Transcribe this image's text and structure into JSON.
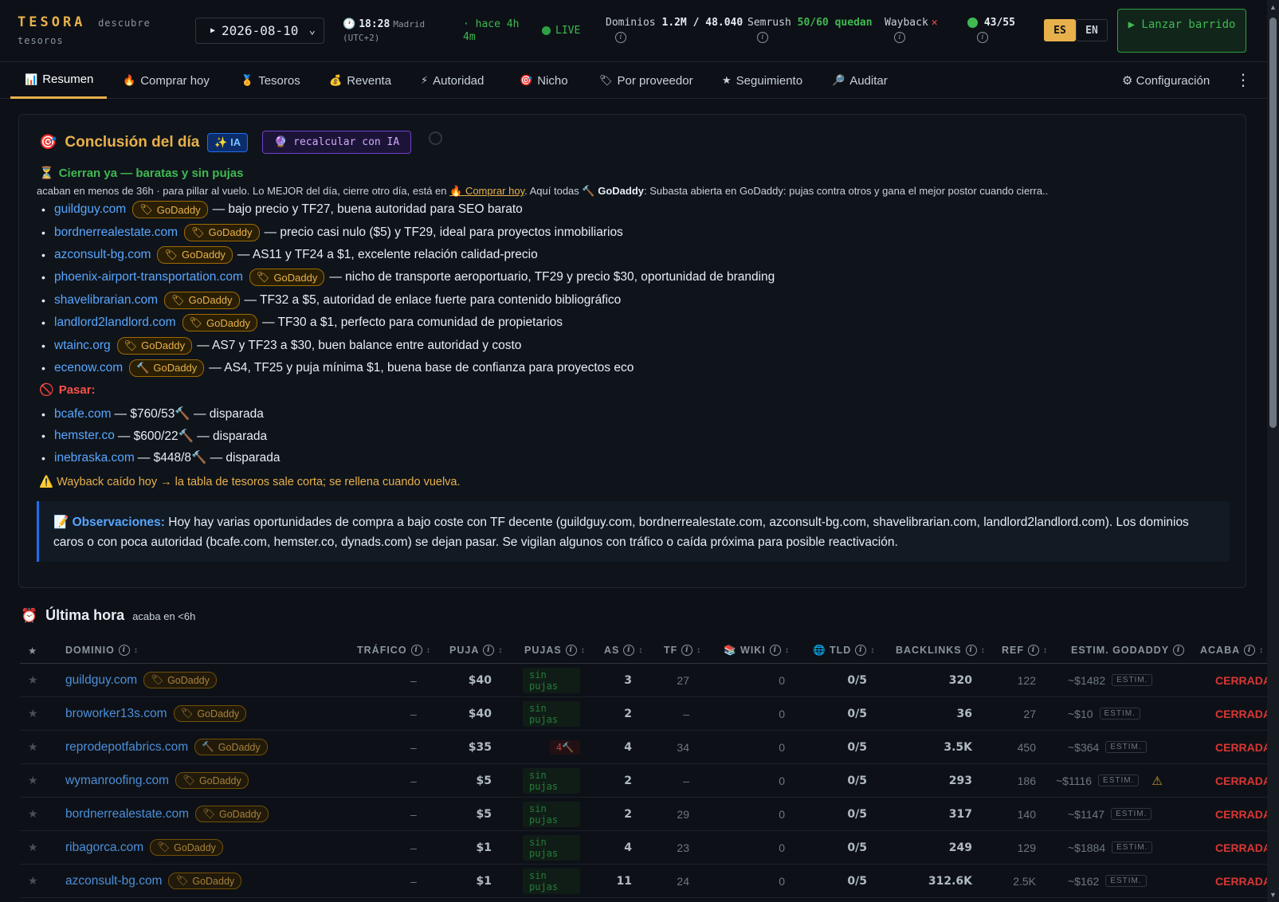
{
  "brand": {
    "name": "TESORA",
    "tagline": "descubre",
    "tagline2": "tesoros"
  },
  "header": {
    "date": "2026-08-10",
    "time": "18:28",
    "city": "Madrid",
    "tz": "(UTC+2)",
    "ago": "· hace 4h 4m",
    "live": "LIVE",
    "dominios_label": "Dominios",
    "dominios_value": "1.2M / 48.040",
    "semrush_label": "Semrush",
    "semrush_value": "50/60 quedan",
    "wayback_label": "Wayback",
    "wayback_status": "✕",
    "counter": "43/55",
    "lang_es": "ES",
    "lang_en": "EN",
    "launch_label": "▶ Lanzar barrido"
  },
  "tabs": [
    {
      "label": "Resumen",
      "icon": "📊"
    },
    {
      "label": "Comprar hoy",
      "icon": "🔥"
    },
    {
      "label": "Tesoros",
      "icon": "🏅"
    },
    {
      "label": "Reventa",
      "icon": "💰"
    },
    {
      "label": "Autoridad",
      "icon": "⚡"
    },
    {
      "label": "Nicho",
      "icon": "🎯"
    },
    {
      "label": "Por proveedor",
      "icon": "🏷"
    },
    {
      "label": "Seguimiento",
      "icon": "★"
    },
    {
      "label": "Auditar",
      "icon": "🔎"
    }
  ],
  "config_label": "⚙ Configuración",
  "conclusion": {
    "title": "Conclusión del día",
    "ia_badge": "✨ IA",
    "recalc_label": "🔮 recalcular con IA",
    "section1_title": "Cierran ya — baratas y sin pujas",
    "sub_a": "acaban en menos de 36h · para pillar al vuelo. Lo MEJOR del día, cierre otro día, está en ",
    "sub_link": "🔥 Comprar hoy",
    "sub_b": ". Aquí todas 🔨 ",
    "sub_bold": "GoDaddy",
    "sub_c": ": Subasta abierta en GoDaddy: pujas contra otros y gana el mejor postor cuando cierra..",
    "godaddy": "GoDaddy",
    "items": [
      {
        "domain": "guildguy.com",
        "icon": "🏷",
        "note": "— bajo precio y TF27, buena autoridad para SEO barato"
      },
      {
        "domain": "bordnerrealestate.com",
        "icon": "🏷",
        "note": "— precio casi nulo ($5) y TF29, ideal para proyectos inmobiliarios"
      },
      {
        "domain": "azconsult-bg.com",
        "icon": "🏷",
        "note": "— AS11 y TF24 a $1, excelente relación calidad-precio"
      },
      {
        "domain": "phoenix-airport-transportation.com",
        "icon": "🏷",
        "note": "— nicho de transporte aeroportuario, TF29 y precio $30, oportunidad de branding"
      },
      {
        "domain": "shavelibrarian.com",
        "icon": "🏷",
        "note": "— TF32 a $5, autoridad de enlace fuerte para contenido bibliográfico"
      },
      {
        "domain": "landlord2landlord.com",
        "icon": "🏷",
        "note": "— TF30 a $1, perfecto para comunidad de propietarios"
      },
      {
        "domain": "wtainc.org",
        "icon": "🏷",
        "note": "— AS7 y TF23 a $30, buen balance entre autoridad y costo"
      },
      {
        "domain": "ecenow.com",
        "icon": "🔨",
        "note": "— AS4, TF25 y puja mínima $1, buena base de confianza para proyectos eco"
      }
    ],
    "pass_title": "Pasar:",
    "pass_items": [
      {
        "domain": "bcafe.com",
        "note": "— $760/53🔨 — disparada"
      },
      {
        "domain": "hemster.co",
        "note": "— $600/22🔨 — disparada"
      },
      {
        "domain": "inebraska.com",
        "note": "— $448/8🔨 — disparada"
      }
    ],
    "warning": "⚠️ Wayback caído hoy → la tabla de tesoros sale corta; se rellena cuando vuelva.",
    "obs_label": "Observaciones:",
    "obs_text": " Hoy hay varias oportunidades de compra a bajo coste con TF decente (guildguy.com, bordnerrealestate.com, azconsult-bg.com, shavelibrarian.com, landlord2landlord.com). Los dominios caros o con poca autoridad (bcafe.com, hemster.co, dynads.com) se dejan pasar. Se vigilan algunos con tráfico o caída próxima para posible reactivación."
  },
  "ultima": {
    "title": "Última hora",
    "subtitle": "acaba en <6h",
    "columns": [
      "★",
      "DOMINIO",
      "TRÁFICO",
      "PUJA",
      "PUJAS",
      "AS",
      "TF",
      "📚 WIKI",
      "🌐 TLD",
      "BACKLINKS",
      "REF",
      "ESTIM. GODADDY",
      "ACABA"
    ],
    "estim_label": "ESTIM.",
    "rows": [
      {
        "domain": "guildguy.com",
        "prov_icon": "🏷",
        "traffic": "–",
        "bid": "$40",
        "bids": "sin pujas",
        "as": "3",
        "tf": "27",
        "wiki": "0",
        "tld": "0/5",
        "backlinks": "320",
        "ref": "122",
        "estim": "~$1482",
        "status": "CERRADA",
        "warn": ""
      },
      {
        "domain": "broworker13s.com",
        "prov_icon": "🏷",
        "traffic": "–",
        "bid": "$40",
        "bids": "sin pujas",
        "as": "2",
        "tf": "–",
        "wiki": "0",
        "tld": "0/5",
        "backlinks": "36",
        "ref": "27",
        "estim": "~$10",
        "status": "CERRADA",
        "warn": ""
      },
      {
        "domain": "reprodepotfabrics.com",
        "prov_icon": "🔨",
        "traffic": "–",
        "bid": "$35",
        "bids": "4🔨",
        "as": "4",
        "tf": "34",
        "wiki": "0",
        "tld": "0/5",
        "backlinks": "3.5K",
        "ref": "450",
        "estim": "~$364",
        "status": "CERRADA",
        "warn": ""
      },
      {
        "domain": "wymanroofing.com",
        "prov_icon": "🏷",
        "traffic": "–",
        "bid": "$5",
        "bids": "sin pujas",
        "as": "2",
        "tf": "–",
        "wiki": "0",
        "tld": "0/5",
        "backlinks": "293",
        "ref": "186",
        "estim": "~$1116",
        "status": "CERRADA",
        "warn": "⚠"
      },
      {
        "domain": "bordnerrealestate.com",
        "prov_icon": "🏷",
        "traffic": "–",
        "bid": "$5",
        "bids": "sin pujas",
        "as": "2",
        "tf": "29",
        "wiki": "0",
        "tld": "0/5",
        "backlinks": "317",
        "ref": "140",
        "estim": "~$1147",
        "status": "CERRADA",
        "warn": ""
      },
      {
        "domain": "ribagorca.com",
        "prov_icon": "🏷",
        "traffic": "–",
        "bid": "$1",
        "bids": "sin pujas",
        "as": "4",
        "tf": "23",
        "wiki": "0",
        "tld": "0/5",
        "backlinks": "249",
        "ref": "129",
        "estim": "~$1884",
        "status": "CERRADA",
        "warn": ""
      },
      {
        "domain": "azconsult-bg.com",
        "prov_icon": "🏷",
        "traffic": "–",
        "bid": "$1",
        "bids": "sin pujas",
        "as": "11",
        "tf": "24",
        "wiki": "0",
        "tld": "0/5",
        "backlinks": "312.6K",
        "ref": "2.5K",
        "estim": "~$162",
        "status": "CERRADA",
        "warn": ""
      }
    ]
  }
}
